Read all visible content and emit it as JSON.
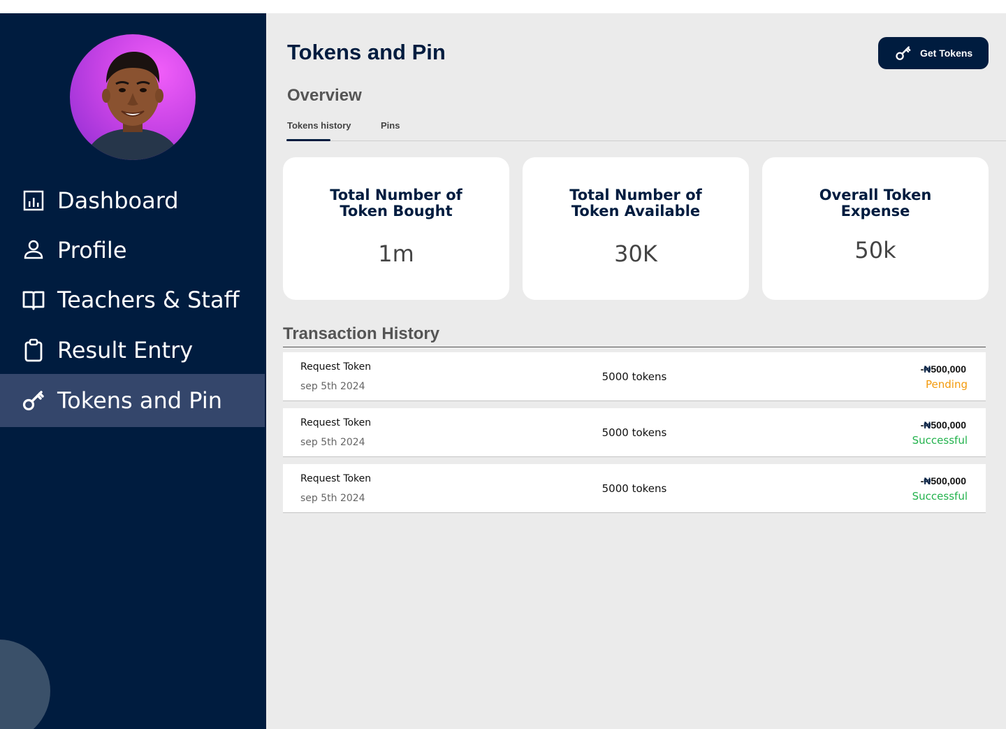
{
  "sidebar": {
    "items": [
      {
        "label": "Dashboard",
        "icon": "bar-chart-icon"
      },
      {
        "label": "Profile",
        "icon": "person-icon"
      },
      {
        "label": "Teachers & Staff",
        "icon": "book-icon"
      },
      {
        "label": "Result Entry",
        "icon": "clipboard-icon"
      },
      {
        "label": "Tokens and Pin",
        "icon": "key-icon",
        "active": true
      }
    ]
  },
  "header": {
    "title": "Tokens and Pin",
    "get_tokens_label": "Get Tokens"
  },
  "overview": {
    "heading": "Overview",
    "tabs": [
      "Tokens history",
      "Pins"
    ],
    "active_tab": "Tokens history"
  },
  "cards": [
    {
      "title": "Total Number of Token Bought",
      "value": "1m"
    },
    {
      "title": "Total Number of Token Available",
      "value": "30K"
    },
    {
      "title": "Overall Token Expense",
      "value": "50k"
    }
  ],
  "transactions": {
    "heading": "Transaction History",
    "currency_symbol": "₦",
    "rows": [
      {
        "label": "Request Token",
        "date": "sep 5th 2024",
        "tokens": "5000 tokens",
        "sign": "-",
        "amount": "500,000",
        "status": "Pending"
      },
      {
        "label": "Request Token",
        "date": "sep 5th 2024",
        "tokens": "5000 tokens",
        "sign": "-",
        "amount": "500,000",
        "status": "Successful"
      },
      {
        "label": "Request Token",
        "date": "sep 5th 2024",
        "tokens": "5000 tokens",
        "sign": "-",
        "amount": "500,000",
        "status": "Successful"
      }
    ]
  },
  "colors": {
    "sidebar_bg": "#001c3f",
    "active_item": "#34466b",
    "pending": "#f39a0c",
    "successful": "#22b24c"
  }
}
